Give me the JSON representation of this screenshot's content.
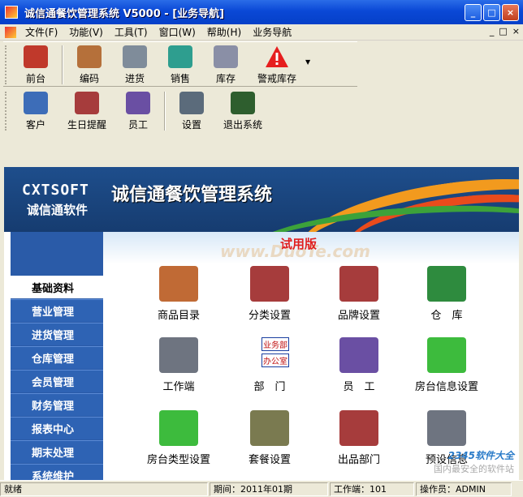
{
  "window": {
    "title": "诚信通餐饮管理系统 V5000 - [业务导航]",
    "buttons": [
      "_",
      "□",
      "×"
    ]
  },
  "menubar": {
    "items": [
      "文件(F)",
      "功能(V)",
      "工具(T)",
      "窗口(W)",
      "帮助(H)",
      "业务导航"
    ],
    "mdi_buttons": [
      "_",
      "□",
      "×"
    ]
  },
  "toolbar1": [
    {
      "label": "前台",
      "icon": "front-desk-icon",
      "color": "#C0392B"
    },
    {
      "label": "编码",
      "icon": "box-icon",
      "color": "#B5703A"
    },
    {
      "label": "进货",
      "icon": "purchase-icon",
      "color": "#7F8C9A"
    },
    {
      "label": "销售",
      "icon": "sales-icon",
      "color": "#2E9E8F"
    },
    {
      "label": "库存",
      "icon": "warehouse-icon",
      "color": "#8A8FA6"
    },
    {
      "label": "警戒库存",
      "icon": "warning-icon",
      "color": "#E61E1E"
    }
  ],
  "toolbar2": [
    {
      "label": "客户",
      "icon": "customer-icon",
      "color": "#3D6DB8"
    },
    {
      "label": "生日提醒",
      "icon": "printer-icon",
      "color": "#A63C3C"
    },
    {
      "label": "员工",
      "icon": "employees-icon",
      "color": "#6A4FA3"
    },
    {
      "label": "设置",
      "icon": "settings-icon",
      "color": "#5B6B7B"
    },
    {
      "label": "退出系统",
      "icon": "exit-icon",
      "color": "#2E5E2E"
    }
  ],
  "banner": {
    "brand_en": "CXTSOFT",
    "brand_cn": "诚信通软件",
    "title": "诚信通餐饮管理系统"
  },
  "sidebar": {
    "items": [
      "基础资料",
      "营业管理",
      "进货管理",
      "仓库管理",
      "会员管理",
      "财务管理",
      "报表中心",
      "期末处理",
      "系统维护"
    ]
  },
  "main": {
    "trial": "试用版",
    "watermark": "www.DuoTe.com",
    "items": [
      {
        "label": "商品目录",
        "icon": "boxes-icon",
        "color": "#C06A35"
      },
      {
        "label": "分类设置",
        "icon": "printer-icon",
        "color": "#A63C3C"
      },
      {
        "label": "品牌设置",
        "icon": "printer-icon",
        "color": "#A63C3C"
      },
      {
        "label": "仓　库",
        "icon": "warehouse-houses-icon",
        "color": "#2E8B3E"
      },
      {
        "label": "工作端",
        "icon": "computer-icon",
        "color": "#6E7480"
      },
      {
        "label": "部　门",
        "icon": "department-icon",
        "color": "#1A3FA0"
      },
      {
        "label": "员　工",
        "icon": "employees-icon",
        "color": "#6A4FA3"
      },
      {
        "label": "房台信息设置",
        "icon": "green-book-icon",
        "color": "#3DBB3D"
      },
      {
        "label": "房台类型设置",
        "icon": "green-book-icon",
        "color": "#3DBB3D"
      },
      {
        "label": "套餐设置",
        "icon": "tools-icon",
        "color": "#7A7A50"
      },
      {
        "label": "出品部门",
        "icon": "printer-icon",
        "color": "#A63C3C"
      },
      {
        "label": "预设信息",
        "icon": "computer-house-icon",
        "color": "#6E7480"
      }
    ],
    "dept_boxes": [
      "业务部",
      "办公室"
    ],
    "corner_brand": "2345软件大全",
    "corner_text": "国内最安全的软件站"
  },
  "statusbar": {
    "ready": "就绪",
    "period": "期间：2011年01期",
    "terminal": "工作端：101",
    "operator": "操作员：ADMIN"
  }
}
